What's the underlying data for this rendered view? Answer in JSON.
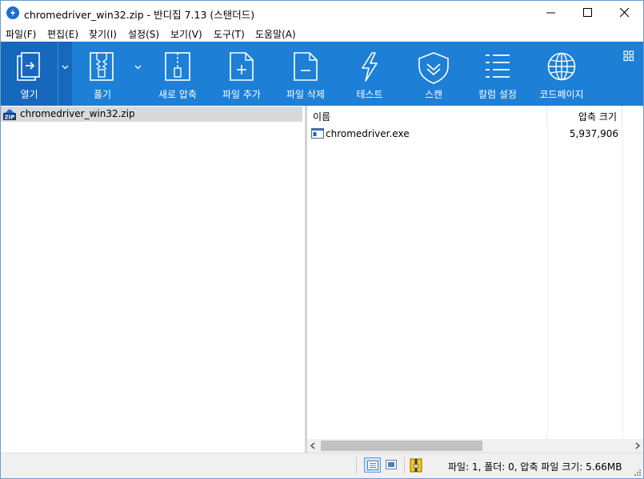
{
  "window": {
    "title": "chromedriver_win32.zip - 반디집 7.13 (스탠더드)"
  },
  "menu": {
    "items": [
      "파일(F)",
      "편집(E)",
      "찾기(I)",
      "설정(S)",
      "보기(V)",
      "도구(T)",
      "도움말(A)"
    ]
  },
  "toolbar": {
    "buttons": [
      {
        "label": "열기",
        "icon": "open-icon"
      },
      {
        "label": "풀기",
        "icon": "extract-icon"
      },
      {
        "label": "새로 압축",
        "icon": "new-archive-icon"
      },
      {
        "label": "파일 추가",
        "icon": "add-file-icon"
      },
      {
        "label": "파일 삭제",
        "icon": "delete-file-icon"
      },
      {
        "label": "테스트",
        "icon": "test-lightning-icon"
      },
      {
        "label": "스캔",
        "icon": "scan-shield-icon"
      },
      {
        "label": "칼럼 설정",
        "icon": "columns-icon"
      },
      {
        "label": "코드페이지",
        "icon": "globe-icon"
      }
    ]
  },
  "tree": {
    "root": "chromedriver_win32.zip"
  },
  "list": {
    "columns": {
      "name": "이름",
      "size": "압축 크기"
    },
    "rows": [
      {
        "name": "chromedriver.exe",
        "size": "5,937,906"
      }
    ]
  },
  "status": {
    "text": "파일: 1, 폴더: 0, 압축 파일 크기: 5.66MB"
  },
  "colors": {
    "toolbar": "#1d7fd6",
    "toolbar_active": "#1668bd",
    "selection": "#d9d9d9"
  }
}
